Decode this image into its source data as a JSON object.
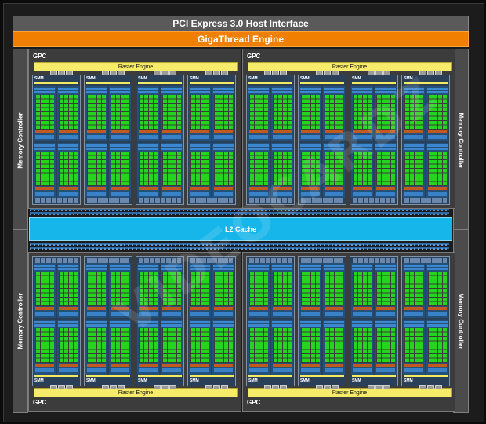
{
  "host_interface": "PCI Express 3.0 Host Interface",
  "gigathread": "GigaThread Engine",
  "memory_controller": "Memory Controller",
  "l2_cache": "L2 Cache",
  "gpc_label": "GPC",
  "raster_engine": "Raster Engine",
  "smm_label": "SMM",
  "watermark": "VIDEOCARDZ",
  "colors": {
    "host": "#5a5a5a",
    "gigathread": "#f07f00",
    "l2_cache": "#17b6ea",
    "raster": "#f6ec6a",
    "cuda_core": "#25d41f",
    "smm_bg": "#2a3f58",
    "sfu": "#c05a1e",
    "ld_st": "#3a82c7",
    "mem_ctl": "#4b4b4b",
    "gpc_bg": "#3c3c3c"
  }
}
